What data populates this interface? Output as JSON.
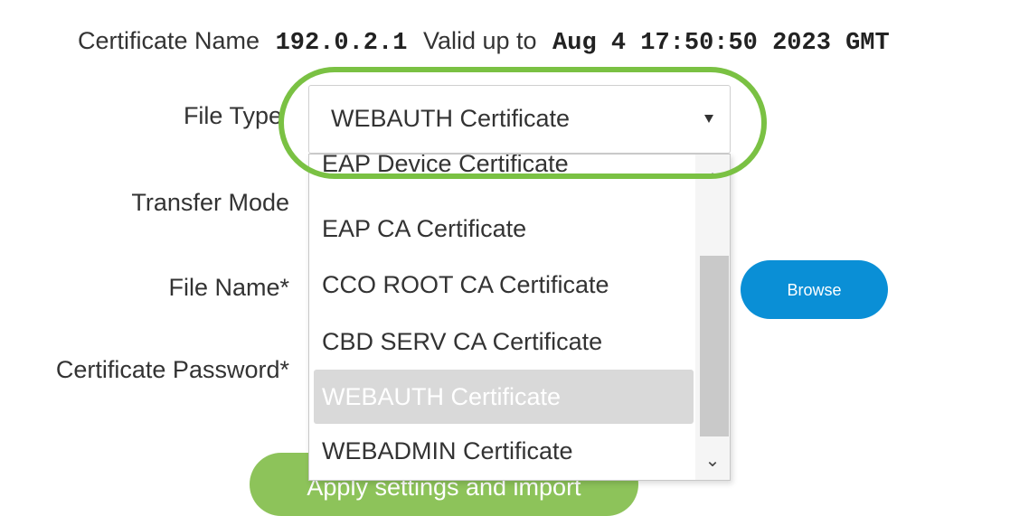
{
  "certificate": {
    "name_label": "Certificate Name",
    "name_value": "192.0.2.1",
    "valid_label": "Valid up to",
    "valid_value": "Aug 4 17:50:50 2023 GMT"
  },
  "form": {
    "file_type_label": "File Type",
    "transfer_mode_label": "Transfer Mode",
    "file_name_label": "File Name*",
    "cert_password_label": "Certificate Password*",
    "browse_label": "Browse",
    "apply_label": "Apply settings and import"
  },
  "file_type_select": {
    "selected": "WEBAUTH Certificate",
    "options": [
      "EAP Device Certificate",
      "EAP CA Certificate",
      "CCO ROOT CA Certificate",
      "CBD SERV CA Certificate",
      "WEBAUTH Certificate",
      "WEBADMIN Certificate"
    ],
    "highlighted_index": 4
  },
  "colors": {
    "highlight_ring": "#7ac143",
    "browse_button": "#0a8fd6",
    "apply_button": "#8dc35a",
    "selected_option_bg": "#d9d9d9"
  }
}
